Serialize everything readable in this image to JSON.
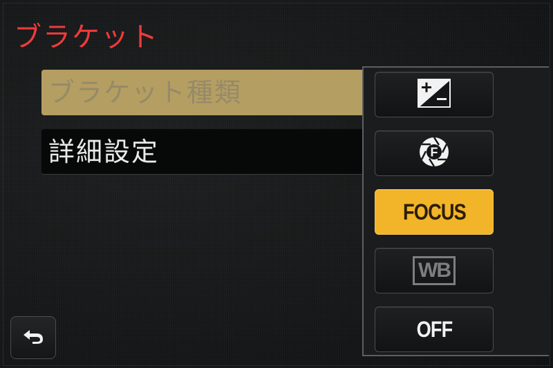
{
  "screen": {
    "title": "ブラケット",
    "title_color": "#f03a3a"
  },
  "menu": {
    "items": [
      {
        "label": "ブラケット種類",
        "state": "selected"
      },
      {
        "label": "詳細設定",
        "state": "normal"
      }
    ]
  },
  "popup": {
    "options": [
      {
        "icon": "exposure-compensation-icon",
        "label": "",
        "selected": false
      },
      {
        "icon": "aperture-f-icon",
        "label": "",
        "selected": false
      },
      {
        "icon": "",
        "label": "FOCUS",
        "selected": true
      },
      {
        "icon": "white-balance-icon",
        "label": "WB",
        "selected": false,
        "dimmed": true
      },
      {
        "icon": "",
        "label": "OFF",
        "selected": false
      }
    ],
    "accent_color": "#f2b428"
  },
  "back_button": {
    "icon": "return-arrow-icon"
  }
}
